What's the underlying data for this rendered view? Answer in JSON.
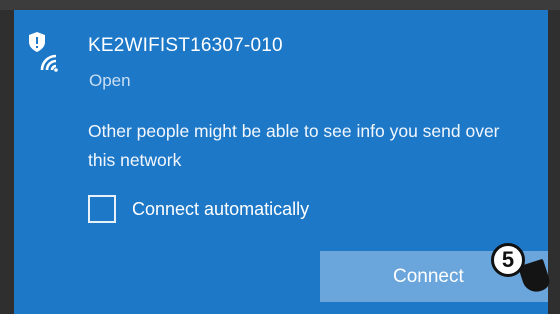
{
  "network": {
    "name": "KE2WIFIST16307-010",
    "status": "Open",
    "icon": "wifi-shield-icon"
  },
  "warning": {
    "text": "Other people might be able to see info you send over this network"
  },
  "auto_connect": {
    "label": "Connect automatically",
    "checked": false
  },
  "connect": {
    "label": "Connect"
  },
  "step_marker": {
    "number": "5"
  },
  "colors": {
    "panel": "#1e78c8",
    "button": "#6aa6db",
    "text": "#ffffff",
    "secondary_text": "#c9dff3"
  }
}
